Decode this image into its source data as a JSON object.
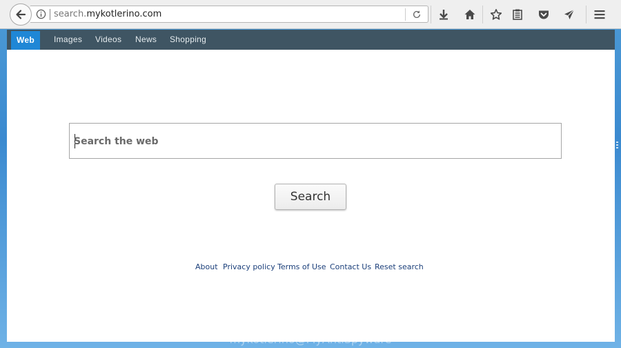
{
  "browser": {
    "url_prefix": "search.",
    "url_domain": "mykotlerino.com",
    "icons": {
      "back": "back-arrow-icon",
      "info": "info-icon",
      "reload": "reload-icon",
      "download": "download-icon",
      "home": "home-icon",
      "bookmark": "star-icon",
      "reading": "reading-list-icon",
      "pocket": "pocket-icon",
      "share": "send-icon",
      "menu": "hamburger-menu-icon"
    }
  },
  "nav": {
    "items": [
      {
        "label": "Web",
        "active": true
      },
      {
        "label": "Images",
        "active": false
      },
      {
        "label": "Videos",
        "active": false
      },
      {
        "label": "News",
        "active": false
      },
      {
        "label": "Shopping",
        "active": false
      }
    ]
  },
  "search": {
    "placeholder": "Search the web",
    "value": "",
    "button_label": "Search"
  },
  "footer": {
    "links": [
      "About",
      "Privacy policy",
      "Terms of Use",
      "Contact Us",
      "Reset search"
    ]
  },
  "watermark": "mykotlerino@MyAntiSpyware",
  "colors": {
    "navbar": "#3f5563",
    "active_tab": "#1f87d6",
    "link": "#1b3f7a"
  }
}
